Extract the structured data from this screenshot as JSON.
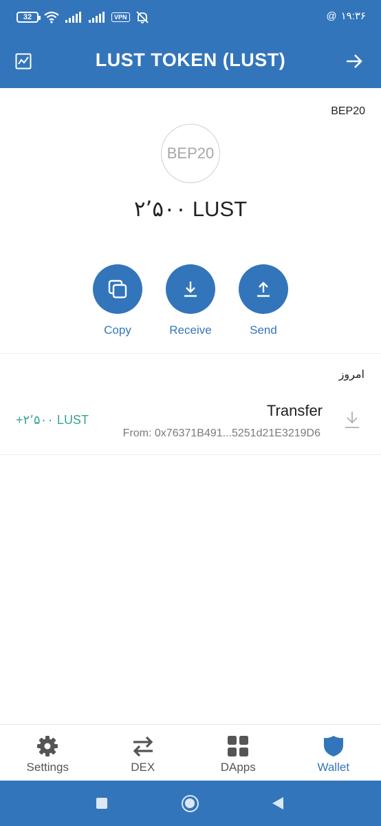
{
  "status_bar": {
    "battery": "32",
    "vpn": "VPN",
    "time": "۱۹:۳۶",
    "at_symbol": "@"
  },
  "app_bar": {
    "title": "LUST TOKEN (LUST)"
  },
  "token": {
    "standard": "BEP20",
    "logo_text": "BEP20",
    "balance": "۲٬۵۰۰ LUST"
  },
  "actions": [
    {
      "label": "Copy",
      "icon": "copy-icon"
    },
    {
      "label": "Receive",
      "icon": "download-icon"
    },
    {
      "label": "Send",
      "icon": "upload-icon"
    }
  ],
  "transactions": {
    "date_header": "امروز",
    "items": [
      {
        "amount": "+۲٬۵۰۰ LUST",
        "title": "Transfer",
        "from": "From: 0x76371B491...5251d21E3219D6",
        "icon": "receive-arrow-icon"
      }
    ]
  },
  "bottom_nav": [
    {
      "label": "Settings",
      "icon": "gear-icon",
      "active": false
    },
    {
      "label": "DEX",
      "icon": "swap-icon",
      "active": false
    },
    {
      "label": "DApps",
      "icon": "grid-icon",
      "active": false
    },
    {
      "label": "Wallet",
      "icon": "shield-icon",
      "active": true
    }
  ],
  "colors": {
    "primary": "#3375bb",
    "positive": "#38a493",
    "icon_gray": "#555555"
  }
}
